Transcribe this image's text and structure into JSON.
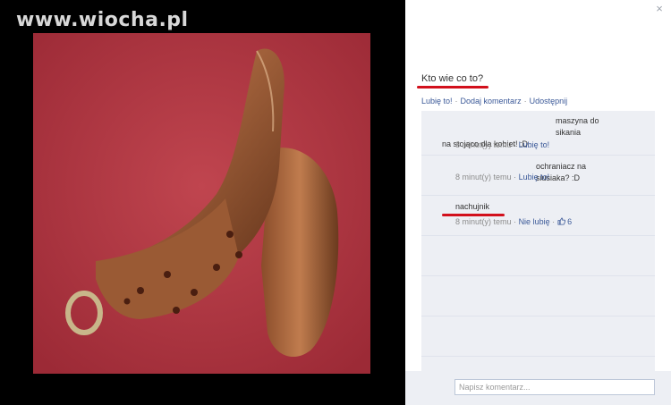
{
  "watermark": "www.wiocha.pl",
  "panel": {
    "close_glyph": "×",
    "caption": "Kto wie co to?",
    "actions": {
      "like": "Lubię to!",
      "comment": "Dodaj komentarz",
      "share": "Udostępnij",
      "separator": "·"
    },
    "comments": [
      {
        "text_line1": "maszyna do sikania",
        "text_line2": "na stojąco dla kobiet! :D",
        "time": "8 minut(y) temu",
        "sep": "·",
        "like": "Lubię to!"
      },
      {
        "text_line1": "ochraniacz na siusiaka? :D",
        "time": "8 minut(y) temu",
        "sep": "·",
        "like": "Lubię to!"
      },
      {
        "text_line1": "nachujnik",
        "time": "8 minut(y) temu",
        "sep": "·",
        "like": "Nie lubię",
        "sep2": "·",
        "like_count": "6"
      }
    ],
    "composer": {
      "placeholder": "Napisz komentarz..."
    }
  },
  "colors": {
    "link": "#3b5998",
    "highlight_underline": "#d2101c",
    "photo_background": "#b53a44"
  },
  "icons": {
    "close": "close-icon",
    "like_count": "thumbs-up-icon"
  }
}
